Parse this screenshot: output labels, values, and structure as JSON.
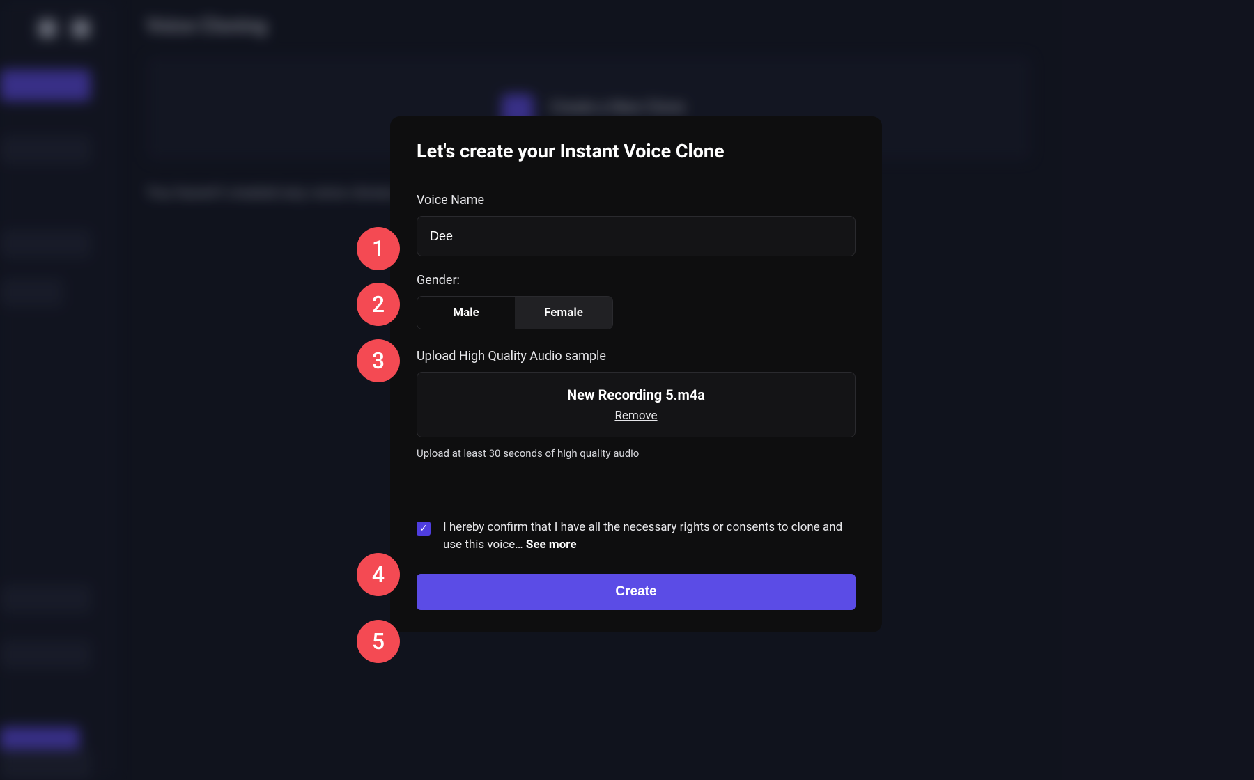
{
  "background": {
    "page_title": "Voice Cloning",
    "new_file_label": "New File",
    "create_card_label": "Create a New Clone",
    "empty_text": "You haven't created any voice clones yet"
  },
  "modal": {
    "title": "Let's create your Instant Voice Clone",
    "voice_name_label": "Voice Name",
    "voice_name_value": "Dee",
    "gender_label": "Gender:",
    "gender_male": "Male",
    "gender_female": "Female",
    "gender_selected": "Female",
    "upload_label": "Upload High Quality Audio sample",
    "uploaded_filename": "New Recording 5.m4a",
    "remove_label": "Remove",
    "upload_hint": "Upload at least 30 seconds of high quality audio",
    "consent_text": "I hereby confirm that I have all the necessary rights or consents to clone and use this voice… ",
    "see_more": "See more",
    "consent_checked": true,
    "create_button": "Create"
  },
  "annotations": {
    "b1": "1",
    "b2": "2",
    "b3": "3",
    "b4": "4",
    "b5": "5"
  },
  "colors": {
    "accent": "#5b4ce6",
    "badge": "#f44a53"
  }
}
